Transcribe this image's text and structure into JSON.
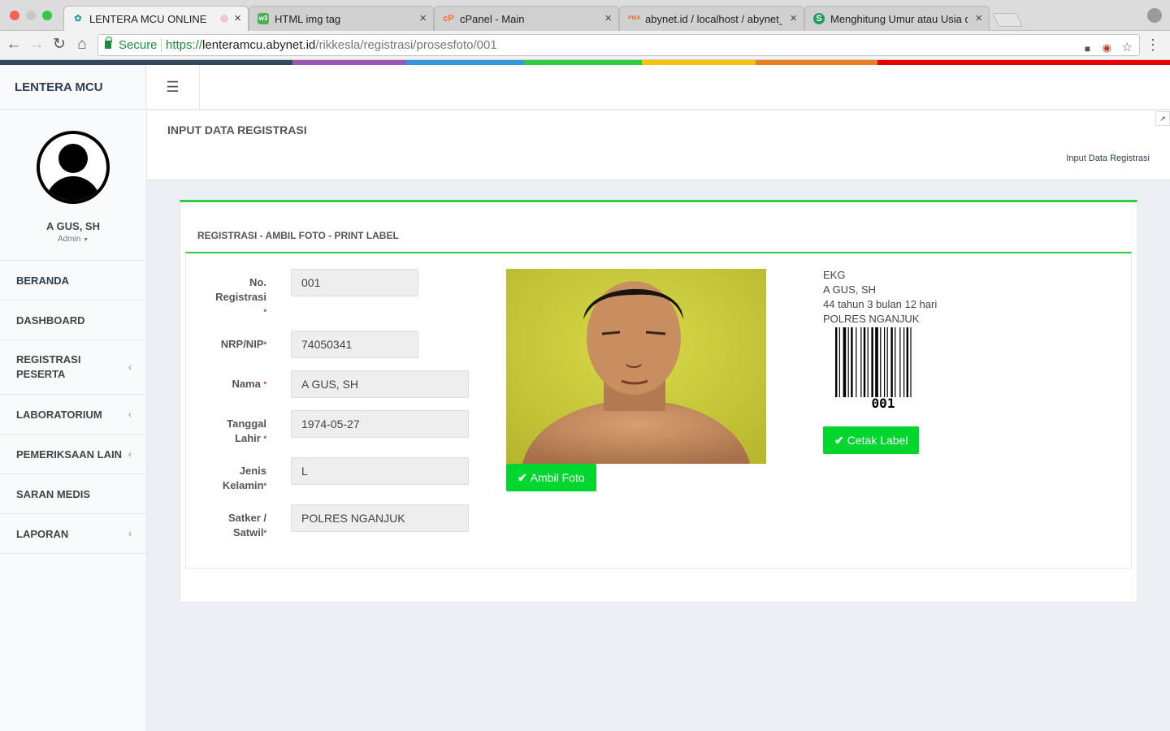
{
  "browser": {
    "tabs": [
      {
        "title": "LENTERA MCU ONLINE",
        "icon": "leaf-favicon",
        "active": true
      },
      {
        "title": "HTML img tag",
        "icon": "w3schools-favicon"
      },
      {
        "title": "cPanel - Main",
        "icon": "cpanel-favicon"
      },
      {
        "title": "abynet.id / localhost / abynet_l",
        "icon": "phpmyadmin-favicon"
      },
      {
        "title": "Menghitung Umur atau Usia de",
        "icon": "s-favicon"
      }
    ],
    "secure_label": "Secure",
    "url_scheme": "https://",
    "url_host": "lenteramcu.abynet.id",
    "url_path": "/rikkesla/registrasi/prosesfoto/001"
  },
  "app": {
    "brand": "LENTERA MCU",
    "toggle_icon": "hamburger-icon",
    "user": {
      "name": "A GUS, SH",
      "role": "Admin"
    },
    "nav": [
      {
        "label": "BERANDA",
        "chevron": false
      },
      {
        "label": "DASHBOARD",
        "chevron": false
      },
      {
        "label": "REGISTRASI PESERTA",
        "chevron": true
      },
      {
        "label": "LABORATORIUM",
        "chevron": true
      },
      {
        "label": "PEMERIKSAAN LAIN",
        "chevron": true
      },
      {
        "label": "SARAN MEDIS",
        "chevron": false
      },
      {
        "label": "LAPORAN",
        "chevron": true
      }
    ]
  },
  "page": {
    "title": "INPUT DATA REGISTRASI",
    "breadcrumb": "Input Data Registrasi"
  },
  "box": {
    "title": "REGISTRASI - AMBIL FOTO - PRINT LABEL"
  },
  "form": {
    "no_registrasi": {
      "label_line1": "No.",
      "label_line2": "Registrasi",
      "value": "001"
    },
    "nrp_nip": {
      "label": "NRP/NIP",
      "value": "74050341"
    },
    "nama": {
      "label": "Nama",
      "value": "A GUS, SH"
    },
    "tanggal_lahir": {
      "label_line1": "Tanggal",
      "label_line2": "Lahir",
      "value": "1974-05-27"
    },
    "jenis_kelamin": {
      "label_line1": "Jenis",
      "label_line2": "Kelamin",
      "value": "L"
    },
    "satker": {
      "label_line1": "Satker /",
      "label_line2": "Satwil",
      "value": "POLRES NGANJUK"
    },
    "required_mark": "*"
  },
  "photo": {
    "button_label": "Ambil Foto",
    "button_icon": "check-icon"
  },
  "label": {
    "line1": "EKG",
    "line2": "A GUS, SH",
    "line3": "44 tahun 3 bulan 12 hari",
    "line4": "POLRES NGANJUK",
    "barcode_text": "001",
    "button_label": "Cetak Label",
    "button_icon": "check-icon"
  },
  "colors": {
    "accent_green": "#00d72e",
    "box_border_green": "#2ecc40",
    "brand_text": "#2c3e50",
    "required_red": "#dd2222"
  }
}
